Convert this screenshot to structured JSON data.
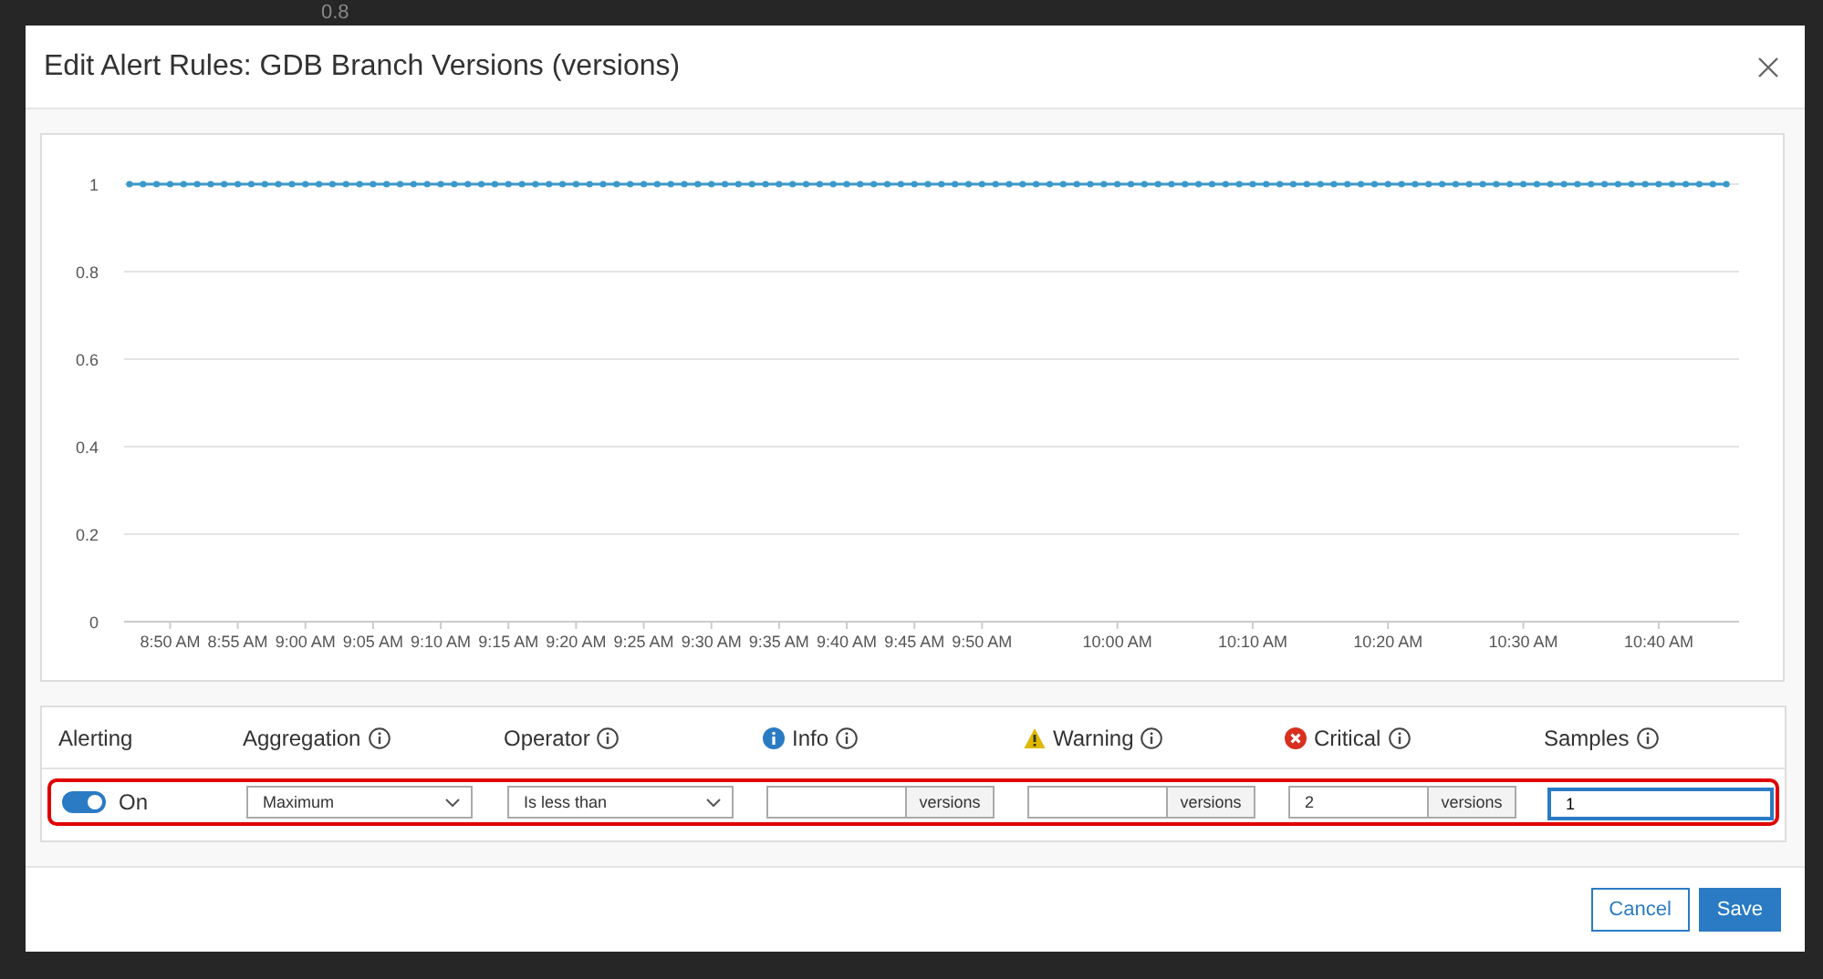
{
  "backdrop_label": "0.8",
  "dialog": {
    "title": "Edit Alert Rules: GDB Branch Versions (versions)"
  },
  "chart_data": {
    "type": "line",
    "grid": true,
    "ylim": [
      0,
      1
    ],
    "yticks": [
      0,
      0.2,
      0.4,
      0.6,
      0.8,
      1
    ],
    "categories": [
      null,
      null,
      null,
      "8:50 AM",
      null,
      null,
      null,
      null,
      "8:55 AM",
      null,
      null,
      null,
      null,
      "9:00 AM",
      null,
      null,
      null,
      null,
      "9:05 AM",
      null,
      null,
      null,
      null,
      "9:10 AM",
      null,
      null,
      null,
      null,
      "9:15 AM",
      null,
      null,
      null,
      null,
      "9:20 AM",
      null,
      null,
      null,
      null,
      "9:25 AM",
      null,
      null,
      null,
      null,
      "9:30 AM",
      null,
      null,
      null,
      null,
      "9:35 AM",
      null,
      null,
      null,
      null,
      "9:40 AM",
      null,
      null,
      null,
      null,
      "9:45 AM",
      null,
      null,
      null,
      null,
      "9:50 AM",
      null,
      null,
      null,
      null,
      null,
      null,
      null,
      null,
      null,
      "10:00 AM",
      null,
      null,
      null,
      null,
      null,
      null,
      null,
      null,
      null,
      "10:10 AM",
      null,
      null,
      null,
      null,
      null,
      null,
      null,
      null,
      null,
      "10:20 AM",
      null,
      null,
      null,
      null,
      null,
      null,
      null,
      null,
      null,
      "10:30 AM",
      null,
      null,
      null,
      null,
      null,
      null,
      null,
      null,
      null,
      "10:40 AM",
      null,
      null,
      null,
      null,
      null
    ],
    "series": [
      {
        "color": "#3b98c9",
        "marker": true,
        "values": [
          1,
          1,
          1,
          1,
          1,
          1,
          1,
          1,
          1,
          1,
          1,
          1,
          1,
          1,
          1,
          1,
          1,
          1,
          1,
          1,
          1,
          1,
          1,
          1,
          1,
          1,
          1,
          1,
          1,
          1,
          1,
          1,
          1,
          1,
          1,
          1,
          1,
          1,
          1,
          1,
          1,
          1,
          1,
          1,
          1,
          1,
          1,
          1,
          1,
          1,
          1,
          1,
          1,
          1,
          1,
          1,
          1,
          1,
          1,
          1,
          1,
          1,
          1,
          1,
          1,
          1,
          1,
          1,
          1,
          1,
          1,
          1,
          1,
          1,
          1,
          1,
          1,
          1,
          1,
          1,
          1,
          1,
          1,
          1,
          1,
          1,
          1,
          1,
          1,
          1,
          1,
          1,
          1,
          1,
          1,
          1,
          1,
          1,
          1,
          1,
          1,
          1,
          1,
          1,
          1,
          1,
          1,
          1,
          1,
          1,
          1,
          1,
          1,
          1,
          1,
          1,
          1,
          1,
          1
        ]
      }
    ]
  },
  "table": {
    "columns": [
      {
        "label": "Alerting",
        "kind": "plain",
        "help": false
      },
      {
        "label": "Aggregation",
        "kind": "plain",
        "help": true
      },
      {
        "label": "Operator",
        "kind": "plain",
        "help": true
      },
      {
        "label": "Info",
        "kind": "info",
        "help": true
      },
      {
        "label": "Warning",
        "kind": "warning",
        "help": true
      },
      {
        "label": "Critical",
        "kind": "critical",
        "help": true
      },
      {
        "label": "Samples",
        "kind": "plain",
        "help": true
      }
    ],
    "row": {
      "highlighted": true,
      "alerting": {
        "on": true,
        "label": "On"
      },
      "aggregation": {
        "value": "Maximum"
      },
      "operator": {
        "value": "Is less than"
      },
      "thresholds": [
        {
          "unit": "versions"
        },
        {
          "unit": "versions"
        },
        {
          "value": "2",
          "unit": "versions"
        }
      ],
      "samples": {
        "value": "1",
        "focused": true
      }
    }
  },
  "buttons": [
    {
      "label": "Cancel",
      "kind": "secondary"
    },
    {
      "label": "Save",
      "kind": "primary"
    }
  ]
}
